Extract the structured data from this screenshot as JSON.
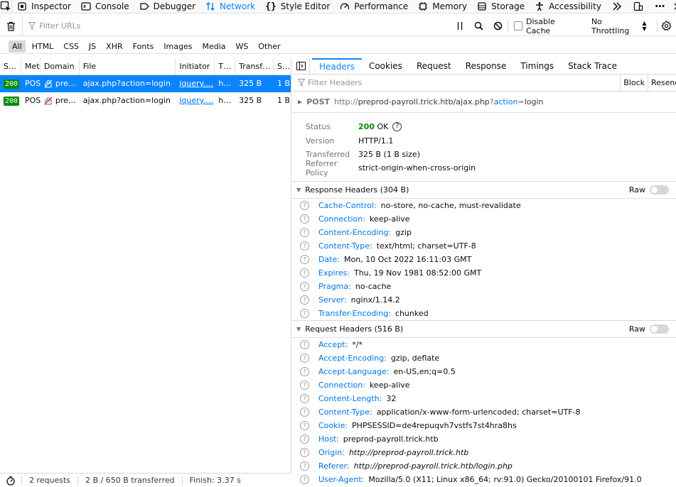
{
  "toolbar": {
    "tabs": [
      {
        "label": "Inspector",
        "icon": "inspector-icon"
      },
      {
        "label": "Console",
        "icon": "console-icon"
      },
      {
        "label": "Debugger",
        "icon": "debugger-icon"
      },
      {
        "label": "Network",
        "icon": "network-icon",
        "active": true
      },
      {
        "label": "Style Editor",
        "icon": "braces-icon"
      },
      {
        "label": "Performance",
        "icon": "gauge-icon"
      },
      {
        "label": "Memory",
        "icon": "memory-icon"
      },
      {
        "label": "Storage",
        "icon": "storage-icon"
      },
      {
        "label": "Accessibility",
        "icon": "accessibility-icon"
      }
    ]
  },
  "filter": {
    "url_placeholder": "Filter URLs",
    "disable_cache": "Disable Cache",
    "throttling": "No Throttling"
  },
  "types": [
    "All",
    "HTML",
    "CSS",
    "JS",
    "XHR",
    "Fonts",
    "Images",
    "Media",
    "WS",
    "Other"
  ],
  "columns": [
    "S…",
    "Met",
    "Domain",
    "File",
    "Initiator",
    "T…",
    "Transf…",
    "S…"
  ],
  "requests": [
    {
      "status": "200",
      "method": "POS",
      "domain": "pre…",
      "file": "ajax.php?action=login",
      "initiator": "jquery.…",
      "type": "h…",
      "transferred": "325 B",
      "size": "1 B",
      "selected": true
    },
    {
      "status": "200",
      "method": "POS",
      "domain": "pre…",
      "file": "ajax.php?action=login",
      "initiator": "jquery.…",
      "type": "h…",
      "transferred": "325 B",
      "size": "1 B",
      "selected": false
    }
  ],
  "statusbar": {
    "requests": "2 requests",
    "transferred": "2 B / 650 B transferred",
    "finish": "Finish: 3.37 s"
  },
  "details": {
    "tabs": [
      "Headers",
      "Cookies",
      "Request",
      "Response",
      "Timings",
      "Stack Trace"
    ],
    "filter_placeholder": "Filter Headers",
    "block_label": "Block",
    "resend_label": "Resend",
    "summary": {
      "method": "POST",
      "url_prefix": "http://",
      "url_main": "preprod-payroll.trick.htb/ajax.php",
      "url_q": "?",
      "url_param": "action",
      "url_eq": "=",
      "url_val": "login"
    },
    "info": {
      "status_label": "Status",
      "status_code": "200",
      "status_text": "OK",
      "version_label": "Version",
      "version": "HTTP/1.1",
      "transferred_label": "Transferred",
      "transferred": "325 B (1 B size)",
      "referrer_label": "Referrer Policy",
      "referrer": "strict-origin-when-cross-origin"
    },
    "raw_label": "Raw",
    "response_headers_title": "Response Headers (304 B)",
    "response_headers": [
      {
        "name": "Cache-Control:",
        "value": "no-store, no-cache, must-revalidate"
      },
      {
        "name": "Connection:",
        "value": "keep-alive"
      },
      {
        "name": "Content-Encoding:",
        "value": "gzip"
      },
      {
        "name": "Content-Type:",
        "value": "text/html; charset=UTF-8"
      },
      {
        "name": "Date:",
        "value": "Mon, 10 Oct 2022 16:11:03 GMT"
      },
      {
        "name": "Expires:",
        "value": "Thu, 19 Nov 1981 08:52:00 GMT"
      },
      {
        "name": "Pragma:",
        "value": "no-cache"
      },
      {
        "name": "Server:",
        "value": "nginx/1.14.2"
      },
      {
        "name": "Transfer-Encoding:",
        "value": "chunked"
      }
    ],
    "request_headers_title": "Request Headers (516 B)",
    "request_headers": [
      {
        "name": "Accept:",
        "value": "*/*"
      },
      {
        "name": "Accept-Encoding:",
        "value": "gzip, deflate"
      },
      {
        "name": "Accept-Language:",
        "value": "en-US,en;q=0.5"
      },
      {
        "name": "Connection:",
        "value": "keep-alive"
      },
      {
        "name": "Content-Length:",
        "value": "32"
      },
      {
        "name": "Content-Type:",
        "value": "application/x-www-form-urlencoded; charset=UTF-8"
      },
      {
        "name": "Cookie:",
        "value": "PHPSESSID=de4repuqvh7vstfs7st4hra8hs"
      },
      {
        "name": "Host:",
        "value": "preprod-payroll.trick.htb"
      },
      {
        "name": "Origin:",
        "value": "http://preprod-payroll.trick.htb"
      },
      {
        "name": "Referer:",
        "value": "http://preprod-payroll.trick.htb/login.php"
      },
      {
        "name": "User-Agent:",
        "value": "Mozilla/5.0 (X11; Linux x86_64; rv:91.0) Gecko/20100101 Firefox/91.0"
      }
    ]
  }
}
